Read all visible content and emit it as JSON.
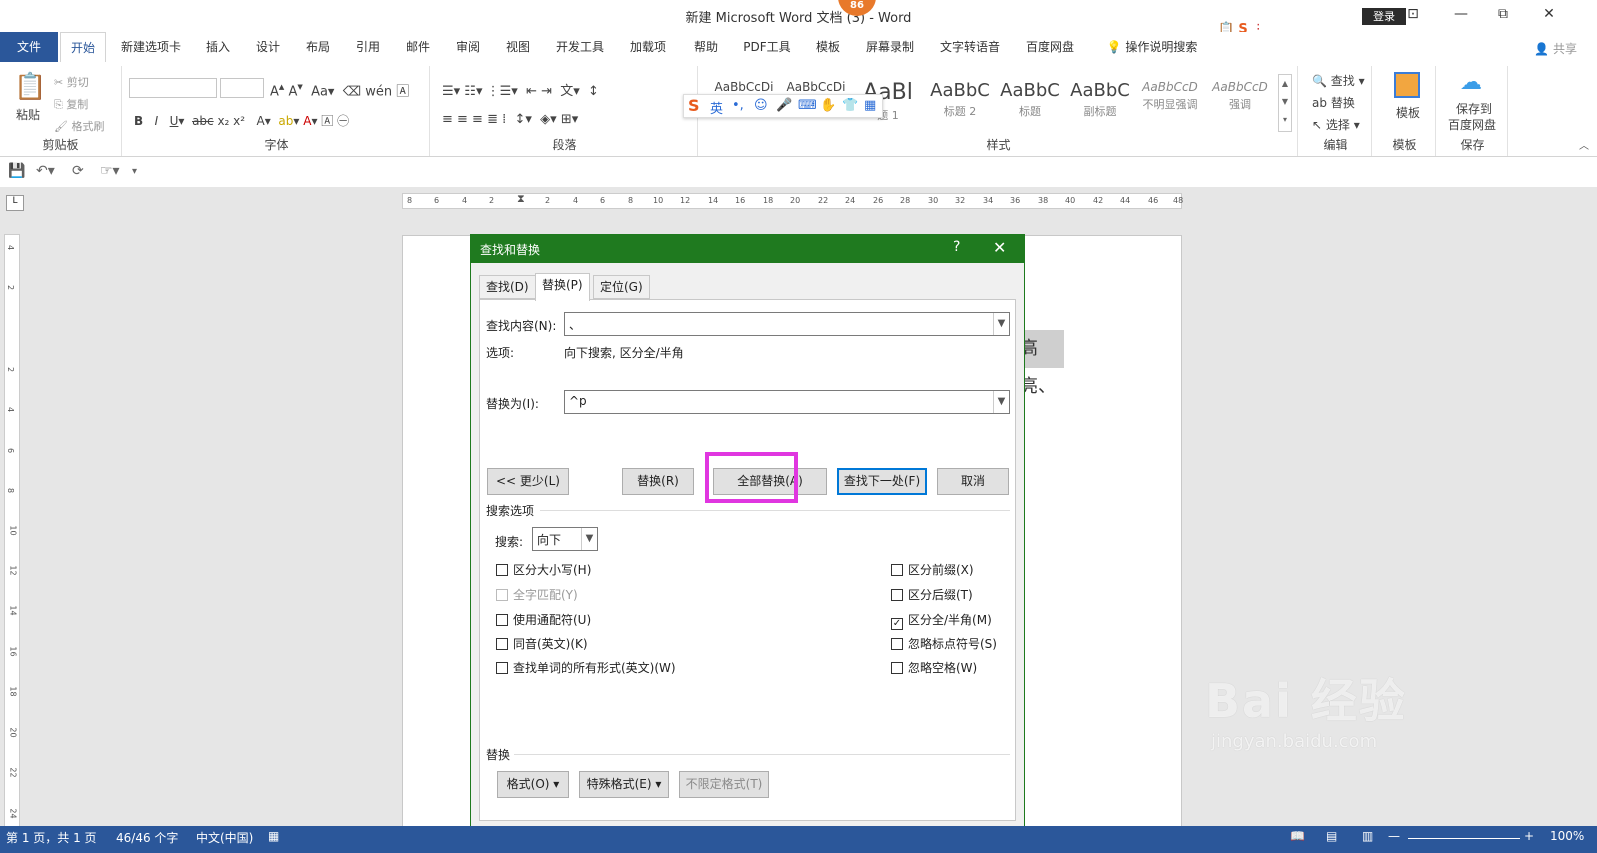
{
  "window": {
    "title": "新建 Microsoft Word 文档 (3) - Word",
    "badge": "86",
    "login": "登录",
    "minimize": "⊡",
    "restore": "⧉",
    "close": "✕"
  },
  "tabs": [
    "文件",
    "开始",
    "新建选项卡",
    "插入",
    "设计",
    "布局",
    "引用",
    "邮件",
    "审阅",
    "视图",
    "开发工具",
    "加载项",
    "帮助",
    "PDF工具",
    "模板",
    "屏幕录制",
    "文字转语音",
    "百度网盘",
    "操作说明搜索"
  ],
  "share": "共享",
  "ribbon": {
    "clipboard": {
      "label": "剪贴板",
      "paste": "粘贴",
      "cut": "剪切",
      "copy": "复制",
      "format_painter": "格式刷"
    },
    "font": {
      "label": "字体"
    },
    "paragraph": {
      "label": "段落"
    },
    "styles": {
      "label": "样式",
      "items": [
        {
          "sample": "AaBbCcDi",
          "name": ""
        },
        {
          "sample": "AaBbCcDi",
          "name": ""
        },
        {
          "sample": "AaBl",
          "name": "题 1"
        },
        {
          "sample": "AaBbC",
          "name": "标题 2"
        },
        {
          "sample": "AaBbC",
          "name": "标题"
        },
        {
          "sample": "AaBbC",
          "name": "副标题"
        },
        {
          "sample": "AaBbCcD",
          "name": "不明显强调"
        },
        {
          "sample": "AaBbCcD",
          "name": "强调"
        }
      ]
    },
    "editing": {
      "label": "编辑",
      "find": "查找",
      "replace": "替换",
      "select": "选择"
    },
    "template": {
      "label": "模板",
      "btn": "模板"
    },
    "save": {
      "label": "保存",
      "btn1": "保存到",
      "btn2": "百度网盘"
    }
  },
  "ime": {
    "lang": "英"
  },
  "ruler": {
    "h": [
      "8",
      "6",
      "4",
      "2",
      "",
      "2",
      "4",
      "6",
      "8",
      "10",
      "12",
      "14",
      "16",
      "18",
      "20",
      "22",
      "24",
      "26",
      "28",
      "30",
      "32",
      "34",
      "36",
      "38",
      "40",
      "42",
      "44",
      "46",
      "48"
    ],
    "v": [
      "4",
      "2",
      "",
      "2",
      "4",
      "6",
      "8",
      "10",
      "12",
      "14",
      "16",
      "18",
      "20",
      "22",
      "24"
    ]
  },
  "document": {
    "visible_text": "高亮、"
  },
  "dialog": {
    "title": "查找和替换",
    "help": "?",
    "close": "✕",
    "tabs": {
      "find": "查找(D)",
      "replace": "替换(P)",
      "goto": "定位(G)"
    },
    "find_label": "查找内容(N):",
    "find_value": "、",
    "options_label": "选项:",
    "options_value": "向下搜索, 区分全/半角",
    "replace_label": "替换为(I):",
    "replace_value": "^p",
    "buttons": {
      "less": "<< 更少(L)",
      "replace": "替换(R)",
      "replace_all": "全部替换(A)",
      "find_next": "查找下一处(F)",
      "cancel": "取消"
    },
    "search_options": "搜索选项",
    "search_label": "搜索:",
    "search_value": "向下",
    "checkboxes_left": [
      {
        "label": "区分大小写(H)",
        "checked": false,
        "disabled": false
      },
      {
        "label": "全字匹配(Y)",
        "checked": false,
        "disabled": true
      },
      {
        "label": "使用通配符(U)",
        "checked": false,
        "disabled": false
      },
      {
        "label": "同音(英文)(K)",
        "checked": false,
        "disabled": false
      },
      {
        "label": "查找单词的所有形式(英文)(W)",
        "checked": false,
        "disabled": false
      }
    ],
    "checkboxes_right": [
      {
        "label": "区分前缀(X)",
        "checked": false,
        "disabled": false
      },
      {
        "label": "区分后缀(T)",
        "checked": false,
        "disabled": false
      },
      {
        "label": "区分全/半角(M)",
        "checked": true,
        "disabled": false
      },
      {
        "label": "忽略标点符号(S)",
        "checked": false,
        "disabled": false
      },
      {
        "label": "忽略空格(W)",
        "checked": false,
        "disabled": false
      }
    ],
    "replace_section": "替换",
    "bottom_buttons": {
      "format": "格式(O) ▾",
      "special": "特殊格式(E) ▾",
      "no_format": "不限定格式(T)"
    }
  },
  "status": {
    "page": "第 1 页，共 1 页",
    "words": "46/46 个字",
    "lang": "中文(中国)",
    "zoom": "100%"
  },
  "watermark": {
    "big": "Bai 经验",
    "small": "jingyan.baidu.com"
  }
}
